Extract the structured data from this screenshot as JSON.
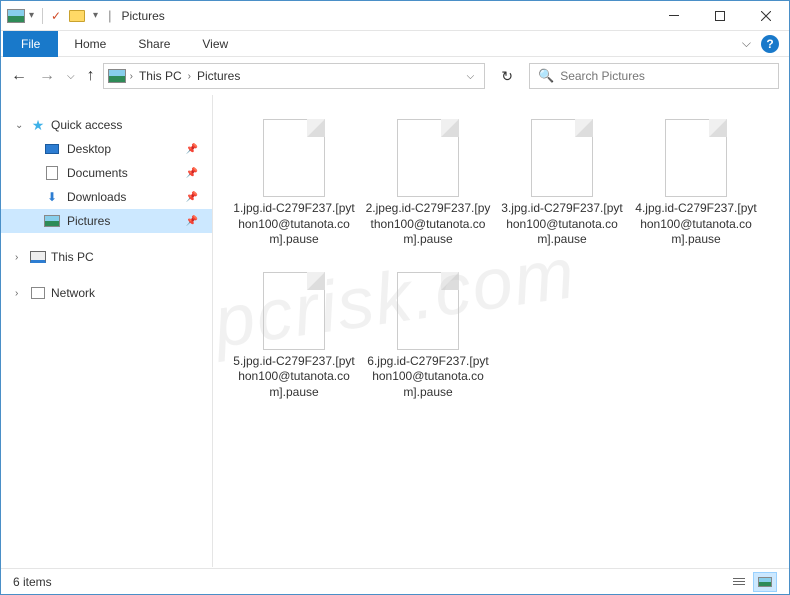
{
  "window": {
    "title": "Pictures"
  },
  "ribbon": {
    "file": "File",
    "tabs": [
      "Home",
      "Share",
      "View"
    ]
  },
  "breadcrumb": {
    "items": [
      "This PC",
      "Pictures"
    ]
  },
  "search": {
    "placeholder": "Search Pictures"
  },
  "nav": {
    "quick_access": "Quick access",
    "items": [
      {
        "label": "Desktop",
        "icon": "desktop"
      },
      {
        "label": "Documents",
        "icon": "doc"
      },
      {
        "label": "Downloads",
        "icon": "download"
      },
      {
        "label": "Pictures",
        "icon": "pic",
        "selected": true
      }
    ],
    "this_pc": "This PC",
    "network": "Network"
  },
  "files": [
    {
      "name": "1.jpg.id-C279F237.[python100@tutanota.com].pause"
    },
    {
      "name": "2.jpeg.id-C279F237.[python100@tutanota.com].pause"
    },
    {
      "name": "3.jpg.id-C279F237.[python100@tutanota.com].pause"
    },
    {
      "name": "4.jpg.id-C279F237.[python100@tutanota.com].pause"
    },
    {
      "name": "5.jpg.id-C279F237.[python100@tutanota.com].pause"
    },
    {
      "name": "6.jpg.id-C279F237.[python100@tutanota.com].pause"
    }
  ],
  "status": {
    "count": "6 items"
  },
  "watermark": "pcrisk.com"
}
